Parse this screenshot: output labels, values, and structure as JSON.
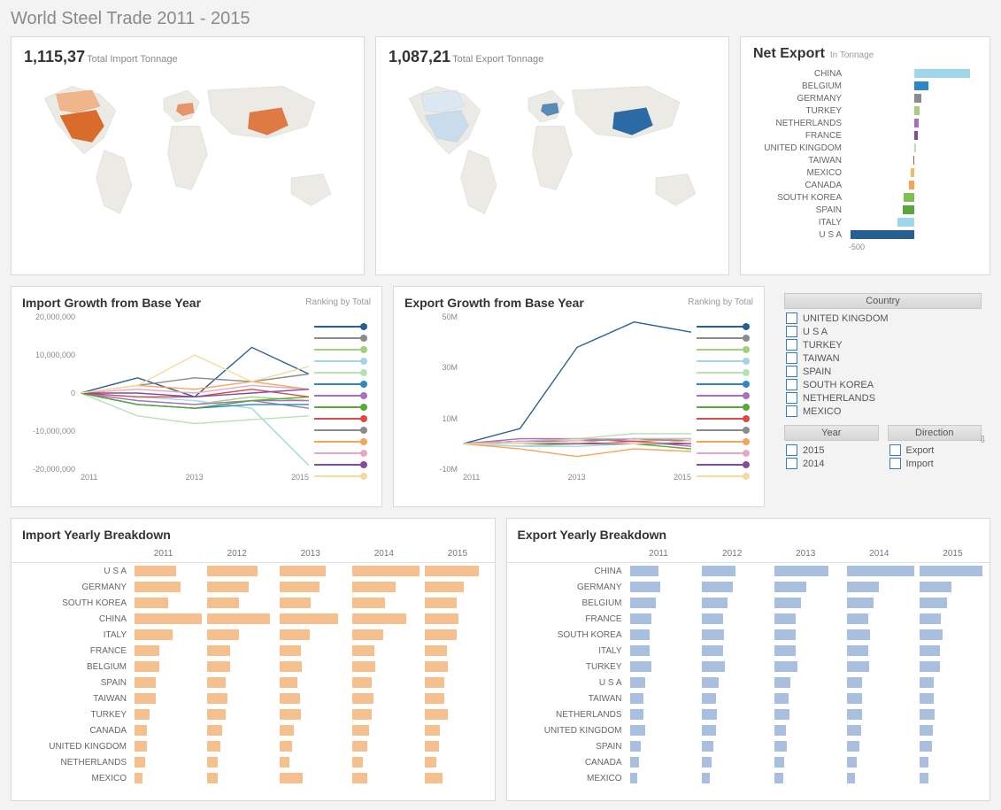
{
  "title": "World Steel Trade 2011 - 2015",
  "kpi": {
    "import_value": "1,115,37",
    "import_label": "Total Import Tonnage",
    "export_value": "1,087,21",
    "export_label": "Total Export Tonnage"
  },
  "net_export": {
    "title": "Net Export",
    "subtitle": "In Tonnage",
    "axis_label": "-500",
    "items": [
      {
        "country": "CHINA",
        "value": 440,
        "color": "#9fd7e8"
      },
      {
        "country": "BELGIUM",
        "value": 110,
        "color": "#2e86c9"
      },
      {
        "country": "GERMANY",
        "value": 55,
        "color": "#8b8b8b"
      },
      {
        "country": "TURKEY",
        "value": 45,
        "color": "#a4d07c"
      },
      {
        "country": "NETHERLANDS",
        "value": 35,
        "color": "#a76ec2"
      },
      {
        "country": "FRANCE",
        "value": 30,
        "color": "#7c4fa0"
      },
      {
        "country": "UNITED KINGDOM",
        "value": 15,
        "color": "#b9e0b1"
      },
      {
        "country": "TAIWAN",
        "value": -10,
        "color": "#d94a4a"
      },
      {
        "country": "MEXICO",
        "value": -25,
        "color": "#f6bb5f"
      },
      {
        "country": "CANADA",
        "value": -45,
        "color": "#f4a55a"
      },
      {
        "country": "SOUTH KOREA",
        "value": -80,
        "color": "#7cc04f"
      },
      {
        "country": "SPAIN",
        "value": -90,
        "color": "#5aa63a"
      },
      {
        "country": "ITALY",
        "value": -130,
        "color": "#9fd7e8"
      },
      {
        "country": "U S A",
        "value": -500,
        "color": "#275f93"
      }
    ]
  },
  "growth_import": {
    "title": "Import Growth from Base Year",
    "note": "Ranking by Total",
    "y_ticks": [
      "20,000,000",
      "10,000,000",
      "0",
      "-10,000,000",
      "-20,000,000"
    ],
    "x_ticks": [
      "2011",
      "2013",
      "2015"
    ]
  },
  "growth_export": {
    "title": "Export Growth from Base Year",
    "note": "Ranking by Total",
    "y_ticks": [
      "50M",
      "30M",
      "10M",
      "-10M"
    ],
    "x_ticks": [
      "2011",
      "2013",
      "2015"
    ]
  },
  "legend_colors": [
    "#275f93",
    "#8b8b8b",
    "#a4d07c",
    "#9fd7e8",
    "#b9e0b1",
    "#2e86c9",
    "#a76ec2",
    "#5aa63a",
    "#d94a4a",
    "#8b8b8b",
    "#f4a55a",
    "#e6a8c0",
    "#7c4fa0",
    "#f4dca0"
  ],
  "filters": {
    "country_header": "Country",
    "countries": [
      "UNITED KINGDOM",
      "U S A",
      "TURKEY",
      "TAIWAN",
      "SPAIN",
      "SOUTH KOREA",
      "NETHERLANDS",
      "MEXICO"
    ],
    "year_header": "Year",
    "years": [
      "2015",
      "2014"
    ],
    "direction_header": "Direction",
    "directions": [
      "Export",
      "Import"
    ]
  },
  "import_breakdown": {
    "title": "Import Yearly Breakdown",
    "years": [
      "2011",
      "2012",
      "2013",
      "2014",
      "2015"
    ]
  },
  "export_breakdown": {
    "title": "Export Yearly Breakdown",
    "years": [
      "2011",
      "2012",
      "2013",
      "2014",
      "2015"
    ]
  },
  "chart_data": [
    {
      "type": "bar",
      "title": "Net Export (In Tonnage)",
      "orientation": "horizontal",
      "categories": [
        "CHINA",
        "BELGIUM",
        "GERMANY",
        "TURKEY",
        "NETHERLANDS",
        "FRANCE",
        "UNITED KINGDOM",
        "TAIWAN",
        "MEXICO",
        "CANADA",
        "SOUTH KOREA",
        "SPAIN",
        "ITALY",
        "U S A"
      ],
      "values": [
        440,
        110,
        55,
        45,
        35,
        30,
        15,
        -10,
        -25,
        -45,
        -80,
        -90,
        -130,
        -500
      ],
      "xlim": [
        -500,
        500
      ],
      "xlabel": "",
      "ylabel": ""
    },
    {
      "type": "line",
      "title": "Import Growth from Base Year",
      "x": [
        2011,
        2012,
        2013,
        2014,
        2015
      ],
      "series": [
        {
          "name": "U S A",
          "values": [
            0,
            4000000,
            -1000000,
            12000000,
            5000000
          ]
        },
        {
          "name": "GERMANY",
          "values": [
            0,
            -3000000,
            -4000000,
            -2000000,
            -4000000
          ]
        },
        {
          "name": "SOUTH KOREA",
          "values": [
            0,
            -2000000,
            -3000000,
            -1000000,
            -2000000
          ]
        },
        {
          "name": "CHINA",
          "values": [
            0,
            -1000000,
            -2000000,
            -4000000,
            -19000000
          ]
        },
        {
          "name": "ITALY",
          "values": [
            0,
            -6000000,
            -8000000,
            -7000000,
            -6000000
          ]
        },
        {
          "name": "FRANCE",
          "values": [
            0,
            -3000000,
            -4000000,
            -3000000,
            -3000000
          ]
        },
        {
          "name": "BELGIUM",
          "values": [
            0,
            -2000000,
            -3000000,
            -2000000,
            -2000000
          ]
        },
        {
          "name": "SPAIN",
          "values": [
            0,
            -3000000,
            -4000000,
            -2000000,
            -1000000
          ]
        },
        {
          "name": "TAIWAN",
          "values": [
            0,
            -1000000,
            -1000000,
            1000000,
            -1000000
          ]
        },
        {
          "name": "TURKEY",
          "values": [
            0,
            2000000,
            4000000,
            3000000,
            5000000
          ]
        },
        {
          "name": "CANADA",
          "values": [
            0,
            2000000,
            1000000,
            3000000,
            1000000
          ]
        },
        {
          "name": "UNITED KINGDOM",
          "values": [
            0,
            1000000,
            0,
            2000000,
            1000000
          ]
        },
        {
          "name": "NETHERLANDS",
          "values": [
            0,
            0,
            -1000000,
            0,
            1000000
          ]
        },
        {
          "name": "MEXICO",
          "values": [
            0,
            2000000,
            10000000,
            3000000,
            7000000
          ]
        }
      ],
      "ylim": [
        -20000000,
        20000000
      ],
      "xlabel": "",
      "ylabel": ""
    },
    {
      "type": "line",
      "title": "Export Growth from Base Year",
      "x": [
        2011,
        2012,
        2013,
        2014,
        2015
      ],
      "series": [
        {
          "name": "CHINA",
          "values": [
            0,
            6000000,
            38000000,
            48000000,
            44000000
          ]
        },
        {
          "name": "GERMANY",
          "values": [
            0,
            0,
            1000000,
            2000000,
            2000000
          ]
        },
        {
          "name": "BELGIUM",
          "values": [
            0,
            -1000000,
            0,
            1000000,
            2000000
          ]
        },
        {
          "name": "FRANCE",
          "values": [
            0,
            -1000000,
            -1000000,
            0,
            0
          ]
        },
        {
          "name": "SOUTH KOREA",
          "values": [
            0,
            2000000,
            2000000,
            4000000,
            4000000
          ]
        },
        {
          "name": "ITALY",
          "values": [
            0,
            1000000,
            1000000,
            2000000,
            1000000
          ]
        },
        {
          "name": "TURKEY",
          "values": [
            0,
            2000000,
            2000000,
            1000000,
            -1000000
          ]
        },
        {
          "name": "U S A",
          "values": [
            0,
            1000000,
            1000000,
            0,
            -2000000
          ]
        },
        {
          "name": "TAIWAN",
          "values": [
            0,
            0,
            0,
            1000000,
            0
          ]
        },
        {
          "name": "NETHERLANDS",
          "values": [
            0,
            1000000,
            1000000,
            2000000,
            1000000
          ]
        },
        {
          "name": "UNITED KINGDOM",
          "values": [
            0,
            -2000000,
            -5000000,
            -2000000,
            -3000000
          ]
        },
        {
          "name": "SPAIN",
          "values": [
            0,
            1000000,
            2000000,
            2000000,
            2000000
          ]
        },
        {
          "name": "CANADA",
          "values": [
            0,
            0,
            0,
            0,
            0
          ]
        },
        {
          "name": "MEXICO",
          "values": [
            0,
            0,
            1000000,
            0,
            1000000
          ]
        }
      ],
      "ylim": [
        -10000000,
        50000000
      ],
      "xlabel": "",
      "ylabel": ""
    },
    {
      "type": "bar",
      "title": "Import Yearly Breakdown",
      "orientation": "horizontal",
      "categories": [
        "U S A",
        "GERMANY",
        "SOUTH KOREA",
        "CHINA",
        "ITALY",
        "FRANCE",
        "BELGIUM",
        "SPAIN",
        "TAIWAN",
        "TURKEY",
        "CANADA",
        "UNITED KINGDOM",
        "NETHERLANDS",
        "MEXICO"
      ],
      "series": [
        {
          "name": "2011",
          "values": [
            50,
            55,
            40,
            80,
            45,
            30,
            30,
            25,
            25,
            18,
            15,
            15,
            13,
            10
          ]
        },
        {
          "name": "2012",
          "values": [
            60,
            50,
            38,
            75,
            38,
            27,
            28,
            22,
            24,
            22,
            18,
            16,
            13,
            13
          ]
        },
        {
          "name": "2013",
          "values": [
            55,
            48,
            37,
            70,
            36,
            26,
            27,
            21,
            24,
            25,
            17,
            15,
            12,
            28
          ]
        },
        {
          "name": "2014",
          "values": [
            80,
            52,
            39,
            65,
            37,
            27,
            28,
            23,
            26,
            24,
            20,
            18,
            13,
            18
          ]
        },
        {
          "name": "2015",
          "values": [
            65,
            47,
            38,
            40,
            38,
            27,
            28,
            24,
            24,
            28,
            18,
            17,
            14,
            22
          ]
        }
      ]
    },
    {
      "type": "bar",
      "title": "Export Yearly Breakdown",
      "orientation": "horizontal",
      "categories": [
        "CHINA",
        "GERMANY",
        "BELGIUM",
        "FRANCE",
        "SOUTH KOREA",
        "ITALY",
        "TURKEY",
        "U S A",
        "TAIWAN",
        "NETHERLANDS",
        "UNITED KINGDOM",
        "SPAIN",
        "CANADA",
        "MEXICO"
      ],
      "series": [
        {
          "name": "2011",
          "values": [
            38,
            40,
            34,
            28,
            26,
            26,
            28,
            20,
            18,
            18,
            20,
            14,
            12,
            10
          ]
        },
        {
          "name": "2012",
          "values": [
            44,
            40,
            33,
            27,
            28,
            27,
            30,
            21,
            18,
            19,
            18,
            15,
            12,
            10
          ]
        },
        {
          "name": "2013",
          "values": [
            70,
            41,
            34,
            27,
            28,
            27,
            30,
            21,
            18,
            19,
            15,
            16,
            12,
            11
          ]
        },
        {
          "name": "2014",
          "values": [
            88,
            42,
            35,
            28,
            30,
            28,
            29,
            20,
            19,
            20,
            18,
            16,
            12,
            10
          ]
        },
        {
          "name": "2015",
          "values": [
            82,
            42,
            36,
            28,
            30,
            27,
            27,
            18,
            18,
            19,
            17,
            16,
            12,
            11
          ]
        }
      ]
    }
  ]
}
